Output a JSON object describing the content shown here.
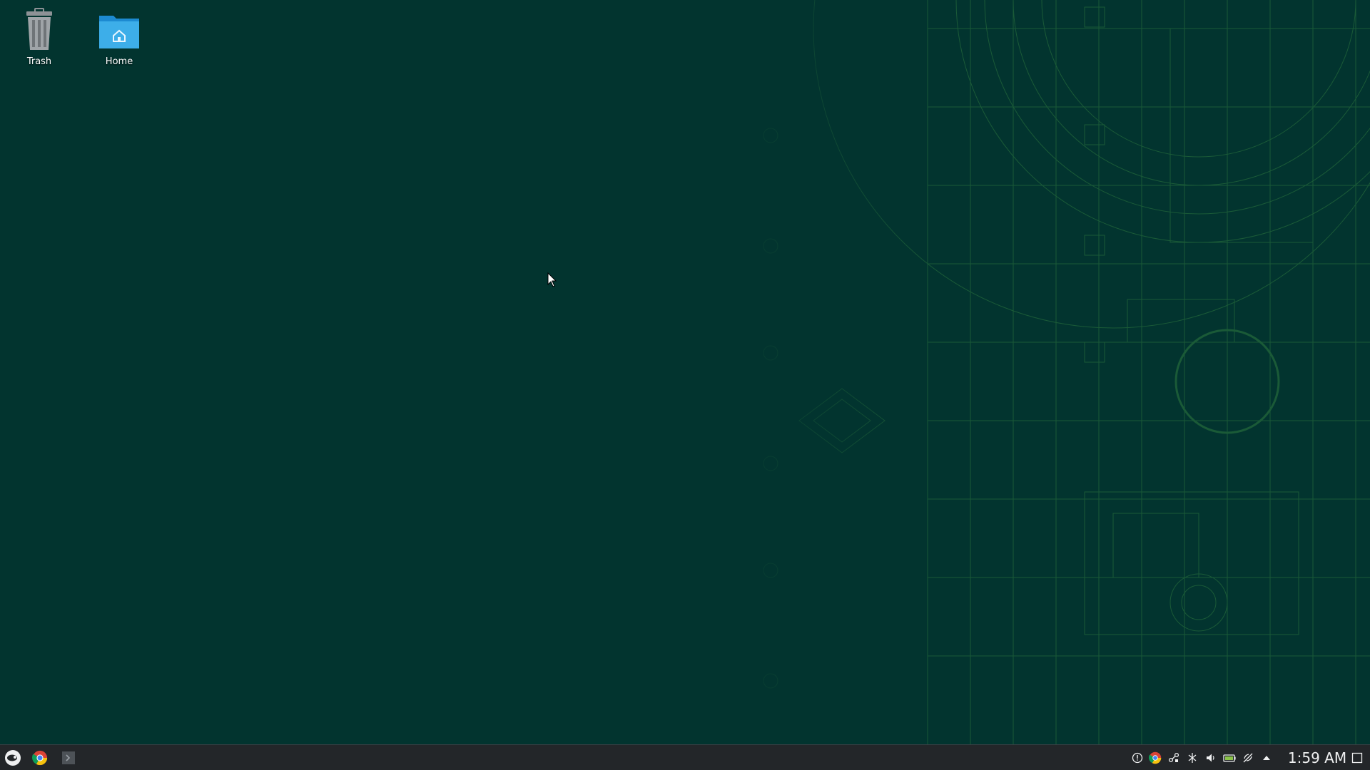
{
  "desktop": {
    "background_color": "#02342f",
    "accent_line_color": "#3f8a4a",
    "icons": [
      {
        "label": "Trash",
        "icon": "trash-icon"
      },
      {
        "label": "Home",
        "icon": "home-folder-icon"
      }
    ]
  },
  "taskbar": {
    "background_color": "#232629",
    "launchers": [
      {
        "icon": "opensuse-menu-icon"
      },
      {
        "icon": "chrome-icon"
      },
      {
        "icon": "terminal-icon"
      }
    ],
    "tray": [
      {
        "icon": "notifications-icon"
      },
      {
        "icon": "chrome-tray-icon"
      },
      {
        "icon": "kde-connect-icon"
      },
      {
        "icon": "bluetooth-icon"
      },
      {
        "icon": "volume-icon"
      },
      {
        "icon": "battery-icon"
      },
      {
        "icon": "network-icon"
      },
      {
        "icon": "expand-tray-icon"
      }
    ],
    "clock": "1:59 AM"
  }
}
